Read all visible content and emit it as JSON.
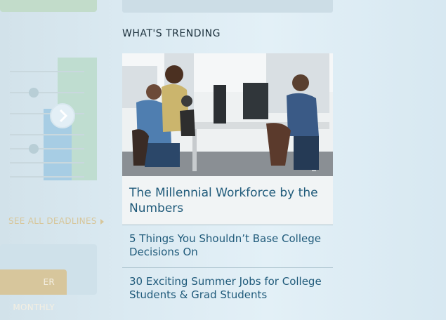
{
  "sidebar": {
    "see_all_label": "SEE ALL DEADLINES",
    "newsletter_button_label": "ER MONTHLY"
  },
  "trending": {
    "heading": "WHAT'S TRENDING",
    "featured": {
      "title": "The Millennial Workforce by the Numbers",
      "image_alt": "Millennial coworkers at a shared workspace"
    },
    "items": [
      {
        "title": "5 Things You Shouldn’t Base College Decisions On"
      },
      {
        "title": "30 Exciting Summer Jobs for College Students & Grad Students"
      }
    ]
  },
  "colors": {
    "link": "#1f5a7a",
    "heading": "#1a2f3b",
    "accent_gold": "#d7c69a",
    "divider": "#a9c1cc"
  }
}
